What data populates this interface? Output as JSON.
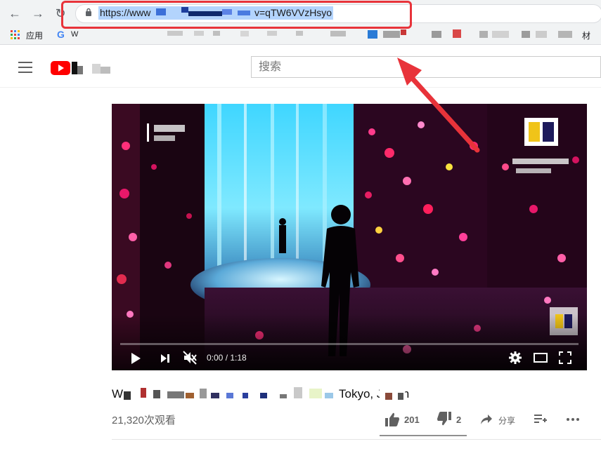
{
  "browser": {
    "url_start": "https://www",
    "url_end": "v=qTW6VVzHsyo",
    "bookmarks": {
      "apps_label": "应用",
      "google_letter": "G",
      "first_label": "W",
      "last_label": "材"
    }
  },
  "youtube": {
    "search": {
      "placeholder": "搜索"
    },
    "player": {
      "time": "0:00 / 1:18",
      "progress": 0.0
    },
    "video": {
      "title_start": "W",
      "title_end": "Tokyo, Japan",
      "views": "21,320次观看",
      "likes": "201",
      "dislikes": "2",
      "share_label": "分享"
    }
  },
  "colors": {
    "annotation_red": "#e8333a",
    "youtube_red": "#ff0000",
    "url_highlight": "#b3d4fd"
  },
  "icons": [
    "back-arrow-icon",
    "forward-arrow-icon",
    "reload-icon",
    "lock-icon",
    "apps-grid-icon",
    "google-g-icon",
    "menu-icon",
    "youtube-logo-icon",
    "play-icon",
    "next-icon",
    "mute-icon",
    "settings-icon",
    "theater-mode-icon",
    "fullscreen-icon",
    "thumbs-up-icon",
    "thumbs-down-icon",
    "share-icon",
    "save-playlist-icon",
    "more-icon"
  ]
}
